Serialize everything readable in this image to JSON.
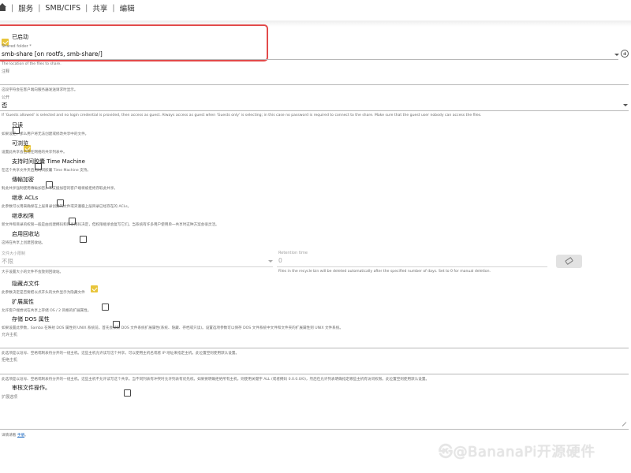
{
  "breadcrumbs": [
    "服务",
    "SMB/CIFS",
    "共享",
    "编辑"
  ],
  "enabled": {
    "label": "已启动",
    "checked": true
  },
  "shared_folder": {
    "label": "Shared folder *",
    "value": "smb-share [on rootfs, smb-share/]",
    "hint": "The location of the files to share."
  },
  "comment": {
    "label": "注释",
    "value": "",
    "hint": "这段字符会在客户端向服务器发送请求时显示。"
  },
  "public": {
    "label": "公开",
    "value": "否",
    "hint": "If 'Guests allowed' is selected and no login credential is provided, then access as guest. Always access as guest when 'Guests only' is selecting; in this case no password is required to connect to the share. Make sure that the guest user nobody can access the files."
  },
  "options": [
    {
      "key": "readonly",
      "label": "只读",
      "checked": false,
      "hint": "如果设定，那么用户将无法创建或修改共享中的文件。"
    },
    {
      "key": "browsable",
      "label": "可浏览",
      "checked": true,
      "hint": "设置此共享会出现在网络的共享列表中。"
    },
    {
      "key": "timemachine",
      "label": "支持时间胶囊 Time Machine",
      "checked": false,
      "hint": "在这个共享文件夹启用时间胶囊 Time Machine 支持。"
    },
    {
      "key": "encrypt",
      "label": "傳輸加密",
      "checked": false,
      "hint": "對此共享強制使用傳輸加密。不支援加密的客户端将被拒绝存取此共享。"
    },
    {
      "key": "inherit_acls",
      "label": "继承 ACLs",
      "checked": false,
      "hint": "此参数可以用来确保在上层目录创建的文件或夹遵循上层目录已经存在的 ACLs。"
    },
    {
      "key": "inherit_perms",
      "label": "继承权限",
      "checked": false,
      "hint": "新文件和目录的权限一般是由创建掩码和目录掩码决定，但权限继承会复写它们。当系统有许多用户使用单一共享时这种方案会很灵活。"
    },
    {
      "key": "recycle",
      "label": "启用回收站",
      "checked": false,
      "hint": "这将在共享上创建回收站。"
    }
  ],
  "max_file_size": {
    "label": "文件大小限制",
    "value": "不限",
    "hint": "大于设置大小的文件不会放到回收站。"
  },
  "retention": {
    "label": "Retention time",
    "value": "0",
    "hint": "Files in the recycle bin will be deleted automatically after the specified number of days. Set to 0 for manual deletion."
  },
  "options2": [
    {
      "key": "hide_dot",
      "label": "隐藏点文件",
      "checked": true,
      "hint": "此参数决定是否要把以点开头的文件显示为隐藏文件"
    },
    {
      "key": "ea",
      "label": "扩展属性",
      "checked": false,
      "hint": "允许客户端尝试在共享上存储 OS / 2 风格的扩展属性。"
    },
    {
      "key": "dos",
      "label": "存储 DOS 属性",
      "checked": false,
      "hint": "如果设置此参数，Samba 在映射 DOS 属性到 UNIX 系统前，首先会读取 DOS 文件系统扩展属性(系统、隐藏、存档或只读)。设置选项参数可以保存 DOS 文件系统中文件和文件夹的扩展属性到 UNIX 文件系统。"
    }
  ],
  "hosts_allow": {
    "label": "允许主机",
    "value": "",
    "hint": "此选项是以逗号、空格或制表符分开的一组主机。这些主机允许读写这个共享。可以使用主机名或者 IP 地址来指定主机。此位置空则使用默认设置。"
  },
  "hosts_deny": {
    "label": "拒绝主机",
    "value": "",
    "hint": "此选项是以逗号、空格或制表符分开的一组主机。这些主机不允许读写这个共享。当不同列表有冲突时允许列表有优先权。如果要明确拒绝所有主机，则使用关键字 ALL (或者掩码 0.0.0.0/0)，然后在允许列表明确指定哪些主机有访问权限。此位置空则使用默认设置。"
  },
  "audit": {
    "label": "审核文件操作。",
    "checked": false
  },
  "extra_options": {
    "label": "扩展选项",
    "value": "",
    "hint_prefix": "详情请看",
    "hint_link": "手册",
    "hint_suffix": "。"
  },
  "watermark": "㉿@BananaPi开源硬件"
}
